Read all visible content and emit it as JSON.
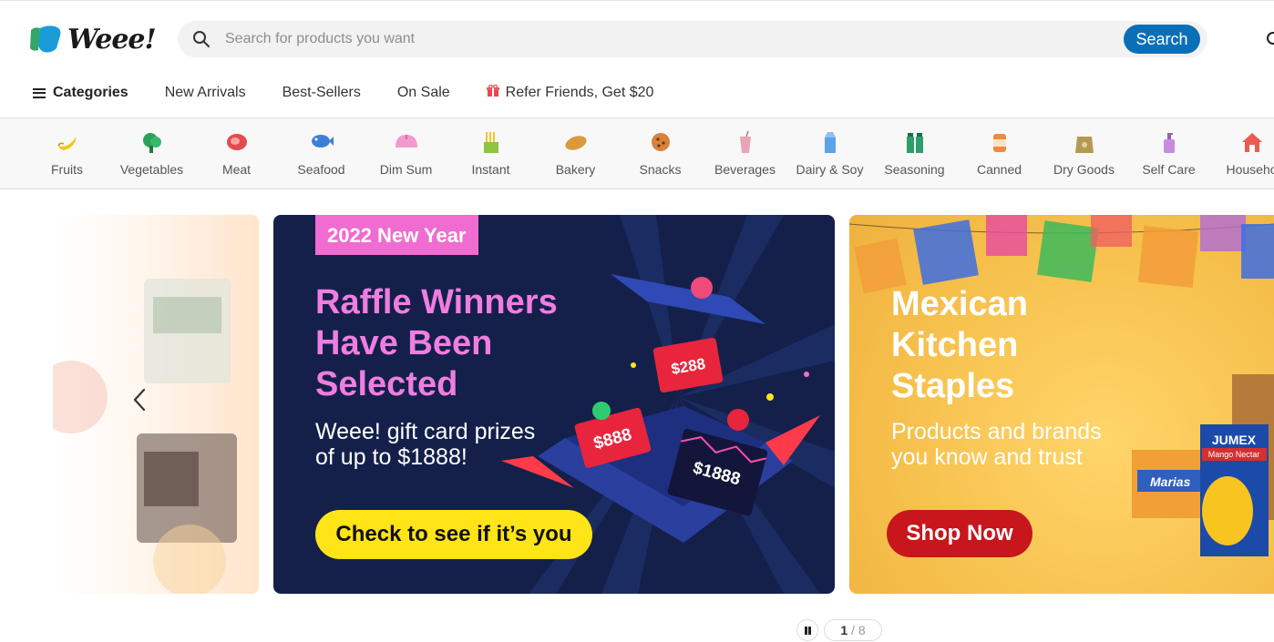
{
  "brand": {
    "name": "Weee!"
  },
  "search": {
    "placeholder": "Search for products you want",
    "button_label": "Search"
  },
  "nav": {
    "categories_label": "Categories",
    "items": [
      "New Arrivals",
      "Best-Sellers",
      "On Sale",
      "Refer Friends, Get $20"
    ]
  },
  "categories": [
    {
      "label": "Fruits",
      "icon": "banana-icon"
    },
    {
      "label": "Vegetables",
      "icon": "vegetable-icon"
    },
    {
      "label": "Meat",
      "icon": "meat-icon"
    },
    {
      "label": "Seafood",
      "icon": "fish-icon"
    },
    {
      "label": "Dim Sum",
      "icon": "bun-icon"
    },
    {
      "label": "Instant",
      "icon": "noodles-icon"
    },
    {
      "label": "Bakery",
      "icon": "bread-icon"
    },
    {
      "label": "Snacks",
      "icon": "cookie-icon"
    },
    {
      "label": "Beverages",
      "icon": "drink-icon"
    },
    {
      "label": "Dairy & Soy",
      "icon": "milk-icon"
    },
    {
      "label": "Seasoning",
      "icon": "bottles-icon"
    },
    {
      "label": "Canned",
      "icon": "can-icon"
    },
    {
      "label": "Dry Goods",
      "icon": "bag-icon"
    },
    {
      "label": "Self Care",
      "icon": "pump-bottle-icon"
    },
    {
      "label": "Househo",
      "icon": "house-icon"
    }
  ],
  "banners": {
    "main": {
      "tag": "2022 New Year",
      "headline": [
        "Raffle Winners",
        "Have Been",
        "Selected"
      ],
      "sub": [
        "Weee! gift card prizes",
        "of up to $1888!"
      ],
      "cta": "Check to see if it’s you",
      "card_values": [
        "$288",
        "$888",
        "$1888"
      ]
    },
    "right": {
      "headline": [
        "Mexican",
        "Kitchen",
        "Staples"
      ],
      "sub": [
        "Products and brands",
        "you know and trust"
      ],
      "cta": "Shop Now",
      "product_labels": [
        "JUMEX",
        "Mango Nectar",
        "Marias"
      ]
    }
  },
  "pager": {
    "current": "1",
    "separator": " / ",
    "total": "8"
  },
  "colors": {
    "accent": "#0b6fb8",
    "yellow_cta": "#ffe418",
    "red_cta": "#c7161c",
    "pink": "#f06cd0",
    "navy": "#14204a"
  }
}
